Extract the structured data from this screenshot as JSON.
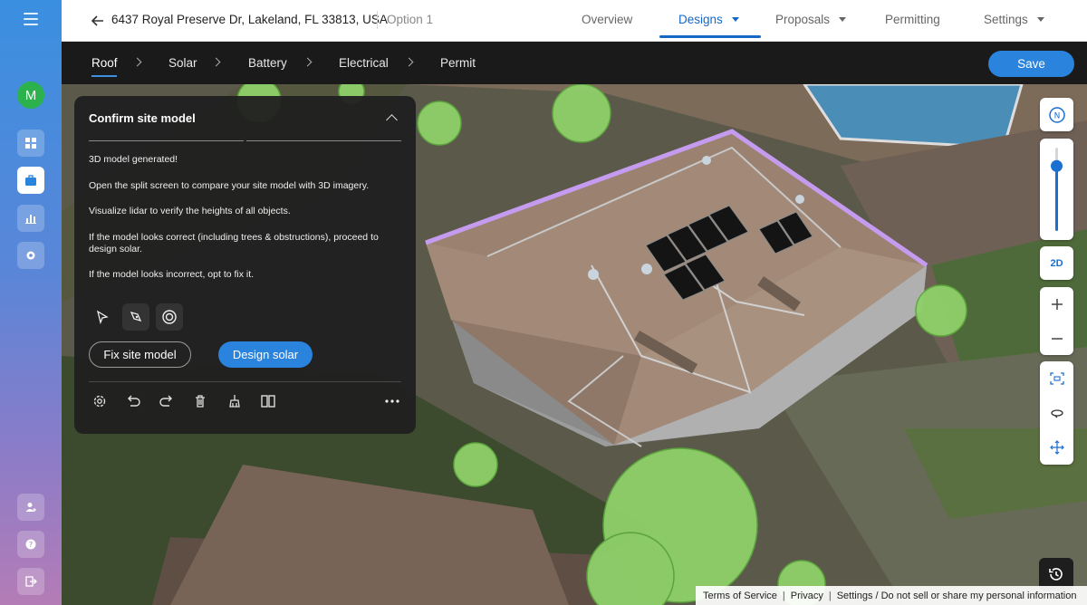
{
  "sidebar": {
    "avatar_letter": "M",
    "icons": [
      "menu-icon",
      "dashboard-icon",
      "briefcase-icon",
      "analytics-icon",
      "settings-icon",
      "add-user-icon",
      "help-icon",
      "logout-icon"
    ]
  },
  "header": {
    "address": "6437 Royal Preserve Dr, Lakeland, FL 33813, USA",
    "option": "Option 1",
    "tabs": [
      {
        "label": "Overview"
      },
      {
        "label": "Designs"
      },
      {
        "label": "Proposals"
      },
      {
        "label": "Permitting"
      },
      {
        "label": "Settings"
      }
    ],
    "active_tab": "Designs"
  },
  "steps": {
    "items": [
      {
        "label": "Roof"
      },
      {
        "label": "Solar"
      },
      {
        "label": "Battery"
      },
      {
        "label": "Electrical"
      },
      {
        "label": "Permit"
      }
    ],
    "active": "Roof",
    "save_label": "Save"
  },
  "panel": {
    "title": "Confirm site model",
    "lines": [
      "3D model generated!",
      "Open the split screen to compare your site model with 3D imagery.",
      "Visualize lidar to verify the heights of all objects.",
      "If the model looks correct (including trees & obstructions), proceed to design solar.",
      "If the model looks incorrect, opt to fix it."
    ],
    "fix_label": "Fix site model",
    "design_label": "Design solar"
  },
  "map_controls": {
    "compass_label": "N",
    "view_toggle": "2D",
    "zoom_level": 0.78
  },
  "footer": {
    "terms": "Terms of Service",
    "privacy": "Privacy",
    "settings": "Settings / Do not sell or share my personal information"
  },
  "colors": {
    "accent": "#2a83dd",
    "tree": "#8fd06a",
    "roof_edge": "#b98be8",
    "avatar": "#2bb24c"
  }
}
